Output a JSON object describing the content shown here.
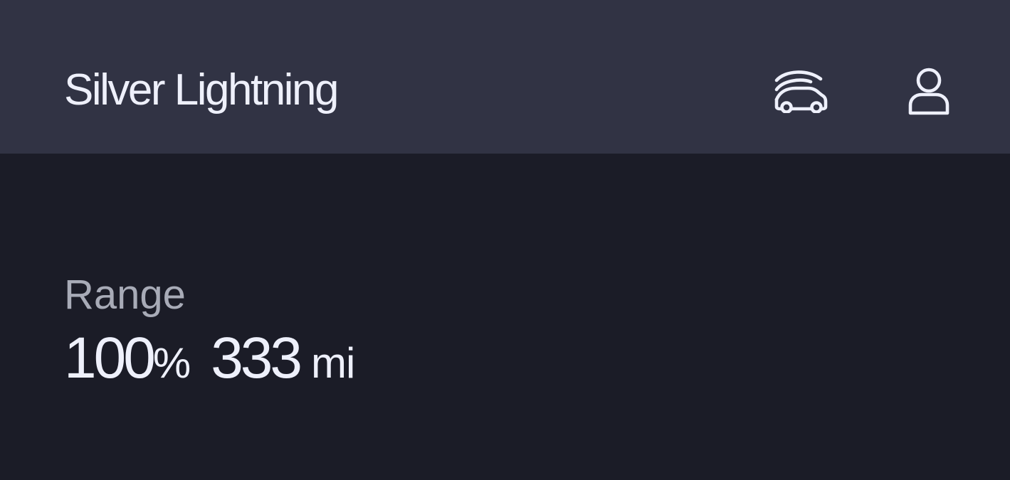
{
  "header": {
    "vehicle_name": "Silver Lightning",
    "garage_icon": "vehicles-garage-icon",
    "account_icon": "user-account-icon"
  },
  "range": {
    "label": "Range",
    "battery_percent": "100",
    "percent_sign": "%",
    "distance": "333",
    "distance_unit": "mi"
  },
  "colors": {
    "header_background": "#313344",
    "page_background": "#1b1c27",
    "primary_text": "#eef0fb",
    "secondary_text": "#a8abb7"
  }
}
